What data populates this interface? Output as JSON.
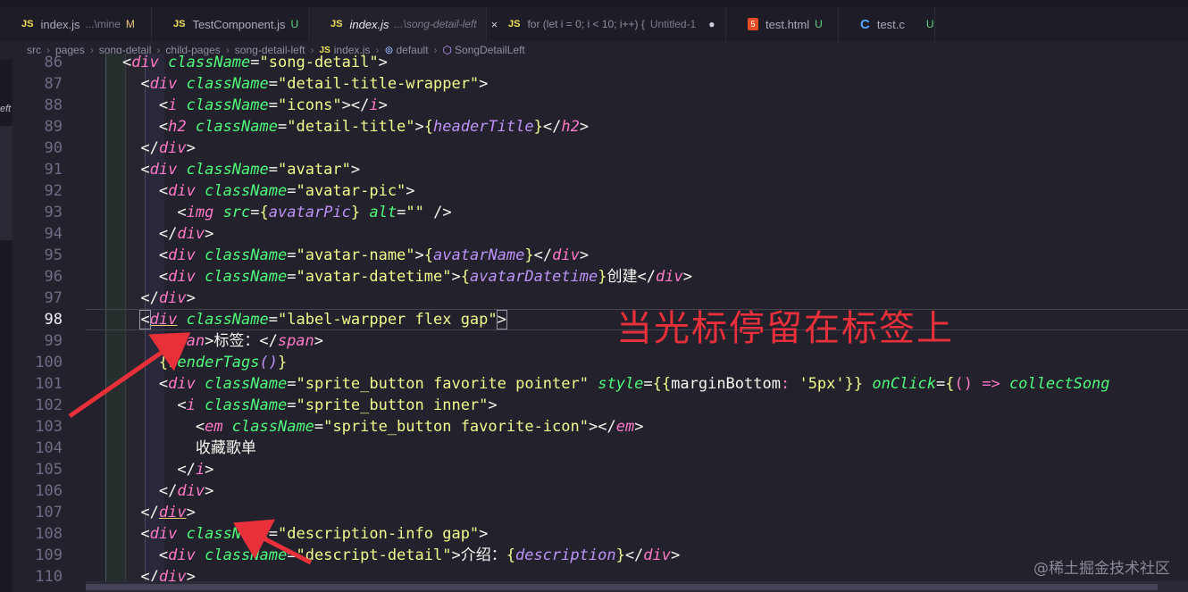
{
  "tabs": [
    {
      "badge": "JS",
      "name": "index.js",
      "desc": "...\\mine",
      "status": "M",
      "active": false
    },
    {
      "badge": "JS",
      "name": "TestComponent.js",
      "desc": "",
      "status": "U",
      "active": false
    },
    {
      "badge": "JS",
      "name": "index.js",
      "desc": "...\\song-detail-left",
      "status": "",
      "close": "×",
      "active": true
    },
    {
      "badge": "JS",
      "name": "for (let i = 0; i < 10; i++) {",
      "desc": "Untitled-1",
      "status": "",
      "dot": "●",
      "active": false
    },
    {
      "badge": "5",
      "name": "test.html",
      "desc": "",
      "status": "U",
      "active": false
    },
    {
      "badge": "C",
      "name": "test.c",
      "desc": "",
      "status": "U",
      "active": false
    }
  ],
  "breadcrumb": {
    "items": [
      "src",
      "pages",
      "song-detail",
      "child-pages",
      "song-detail-left"
    ],
    "file_badge": "JS",
    "file": "index.js",
    "symbol1": "default",
    "symbol2": "SongDetailLeft"
  },
  "sidebar": {
    "label": "eft"
  },
  "line_numbers": [
    "86",
    "87",
    "88",
    "89",
    "90",
    "91",
    "92",
    "93",
    "94",
    "95",
    "96",
    "97",
    "98",
    "99",
    "100",
    "101",
    "102",
    "103",
    "104",
    "105",
    "106",
    "107",
    "108",
    "109",
    "110"
  ],
  "current_line": "98",
  "code": {
    "l86": {
      "indent": "    ",
      "t1": "<",
      "tag": "div",
      "a": " className",
      "eq": "=",
      "s": "\"song-detail\"",
      "t2": ">"
    },
    "l87": {
      "indent": "      ",
      "t1": "<",
      "tag": "div",
      "a": " className",
      "eq": "=",
      "s": "\"detail-title-wrapper\"",
      "t2": ">"
    },
    "l88": {
      "indent": "        ",
      "t1": "<",
      "tag": "i",
      "a": " className",
      "eq": "=",
      "s": "\"icons\"",
      "t2": "></",
      "tag2": "i",
      "t3": ">"
    },
    "l89": {
      "indent": "        ",
      "t1": "<",
      "tag": "h2",
      "a": " className",
      "eq": "=",
      "s": "\"detail-title\"",
      "t2": ">",
      "b1": "{",
      "expr": "headerTitle",
      "b2": "}",
      "t3": "</",
      "tag2": "h2",
      "t4": ">"
    },
    "l90": {
      "indent": "      ",
      "t1": "</",
      "tag": "div",
      "t2": ">"
    },
    "l91": {
      "indent": "      ",
      "t1": "<",
      "tag": "div",
      "a": " className",
      "eq": "=",
      "s": "\"avatar\"",
      "t2": ">"
    },
    "l92": {
      "indent": "        ",
      "t1": "<",
      "tag": "div",
      "a": " className",
      "eq": "=",
      "s": "\"avatar-pic\"",
      "t2": ">"
    },
    "l93": {
      "indent": "          ",
      "t1": "<",
      "tag": "img",
      "a": " src",
      "eq": "=",
      "b1": "{",
      "expr": "avatarPic",
      "b2": "}",
      "a2": " alt",
      "eq2": "=",
      "s": "\"\"",
      "t2": " />"
    },
    "l94": {
      "indent": "        ",
      "t1": "</",
      "tag": "div",
      "t2": ">"
    },
    "l95": {
      "indent": "        ",
      "t1": "<",
      "tag": "div",
      "a": " className",
      "eq": "=",
      "s": "\"avatar-name\"",
      "t2": ">",
      "b1": "{",
      "expr": "avatarName",
      "b2": "}",
      "t3": "</",
      "tag2": "div",
      "t4": ">"
    },
    "l96": {
      "indent": "        ",
      "t1": "<",
      "tag": "div",
      "a": " className",
      "eq": "=",
      "s": "\"avatar-datetime\"",
      "t2": ">",
      "b1": "{",
      "expr": "avatarDatetime",
      "b2": "}",
      "txt": "创建",
      "t3": "</",
      "tag2": "div",
      "t4": ">"
    },
    "l97": {
      "indent": "      ",
      "t1": "</",
      "tag": "div",
      "t2": ">"
    },
    "l98": {
      "indent": "      ",
      "t1": "<",
      "tag": "div",
      "a": " className",
      "eq": "=",
      "s": "\"label-warpper flex gap\"",
      "t2": ">"
    },
    "l99": {
      "indent": "        ",
      "t1": "<",
      "tag": "span",
      "t2": ">",
      "txt": "标签：",
      "t3": "</",
      "tag2": "span",
      "t4": ">"
    },
    "l100": {
      "indent": "        ",
      "b1": "{",
      "fn": "renderTags",
      "p": "()",
      "b2": "}"
    },
    "l101": {
      "indent": "        ",
      "t1": "<",
      "tag": "div",
      "a": " className",
      "eq": "=",
      "s": "\"sprite_button favorite pointer\"",
      "a2": " style",
      "eq2": "=",
      "b1": "{{",
      "k": "marginBottom",
      "c": ": ",
      "v": "'5px'",
      "b2": "}}",
      "a3": " onClick",
      "eq3": "=",
      "b3": "{",
      "arrow": "() => ",
      "fn": "collectSong"
    },
    "l102": {
      "indent": "          ",
      "t1": "<",
      "tag": "i",
      "a": " className",
      "eq": "=",
      "s": "\"sprite_button inner\"",
      "t2": ">"
    },
    "l103": {
      "indent": "            ",
      "t1": "<",
      "tag": "em",
      "a": " className",
      "eq": "=",
      "s": "\"sprite_button favorite-icon\"",
      "t2": "></",
      "tag2": "em",
      "t3": ">"
    },
    "l104": {
      "indent": "            ",
      "txt": "收藏歌单"
    },
    "l105": {
      "indent": "          ",
      "t1": "</",
      "tag": "i",
      "t2": ">"
    },
    "l106": {
      "indent": "        ",
      "t1": "</",
      "tag": "div",
      "t2": ">"
    },
    "l107": {
      "indent": "      ",
      "t1": "</",
      "tag": "div",
      "t2": ">"
    },
    "l108": {
      "indent": "      ",
      "t1": "<",
      "tag": "div",
      "a": " className",
      "eq": "=",
      "s": "\"description-info gap\"",
      "t2": ">"
    },
    "l109": {
      "indent": "        ",
      "t1": "<",
      "tag": "div",
      "a": " className",
      "eq": "=",
      "s": "\"descript-detail\"",
      "t2": ">",
      "txt": "介绍：",
      "b1": "{",
      "expr": "description",
      "b2": "}",
      "t3": "</",
      "tag2": "div",
      "t4": ">"
    },
    "l110": {
      "indent": "      ",
      "t1": "</",
      "tag": "div",
      "t2": ">"
    }
  },
  "annotation": "当光标停留在标签上",
  "watermark": "@稀土掘金技术社区",
  "colors": {
    "annotation": "#e8303a",
    "tag": "#ff79c6",
    "attr": "#50fa7b",
    "string": "#f1fa8c",
    "expr": "#bd93f9"
  }
}
